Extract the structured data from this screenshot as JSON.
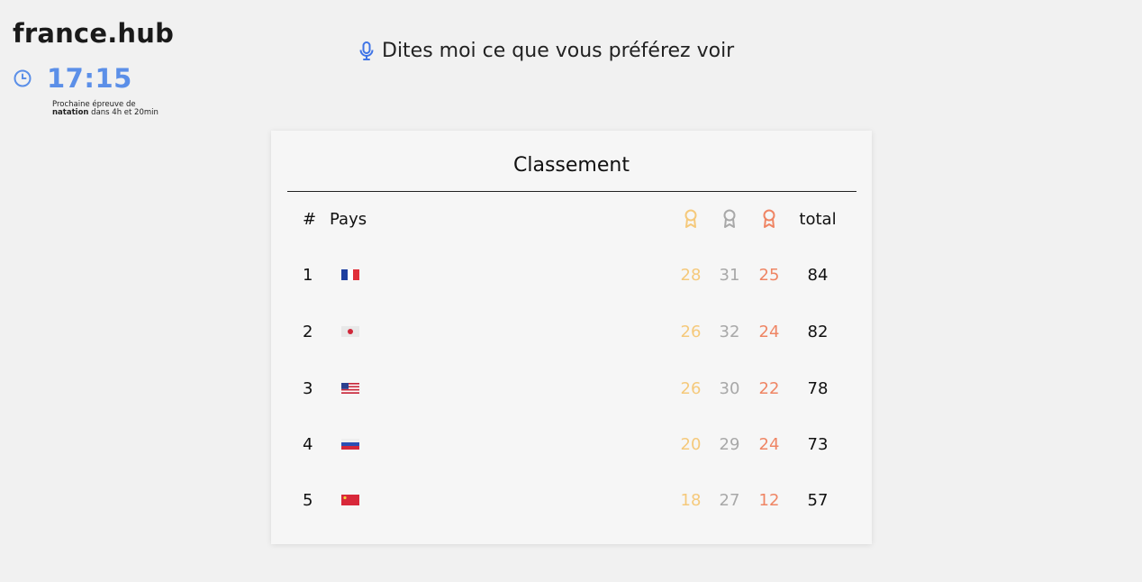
{
  "brand": "france.hub",
  "clock": {
    "time": "17:15",
    "next_event_prefix": "Prochaine épreuve de ",
    "next_event_sport": "natation",
    "next_event_suffix": " dans 4h et 20min"
  },
  "voice_prompt": "Dites moi ce que vous préférez voir",
  "ranking": {
    "title": "Classement",
    "headers": {
      "rank": "#",
      "country": "Pays",
      "gold_icon": "gold-medal-icon",
      "silver_icon": "silver-medal-icon",
      "bronze_icon": "bronze-medal-icon",
      "total": "total"
    },
    "rows": [
      {
        "rank": "1",
        "flag": "france-flag-icon",
        "gold": "28",
        "silver": "31",
        "bronze": "25",
        "total": "84"
      },
      {
        "rank": "2",
        "flag": "japan-flag-icon",
        "gold": "26",
        "silver": "32",
        "bronze": "24",
        "total": "82"
      },
      {
        "rank": "3",
        "flag": "usa-flag-icon",
        "gold": "26",
        "silver": "30",
        "bronze": "22",
        "total": "78"
      },
      {
        "rank": "4",
        "flag": "russia-flag-icon",
        "gold": "20",
        "silver": "29",
        "bronze": "24",
        "total": "73"
      },
      {
        "rank": "5",
        "flag": "china-flag-icon",
        "gold": "18",
        "silver": "27",
        "bronze": "12",
        "total": "57"
      }
    ]
  },
  "colors": {
    "accent_blue": "#5b8fe8",
    "gold": "#f5c97b",
    "silver": "#a8a8a8",
    "bronze": "#ef8564"
  }
}
